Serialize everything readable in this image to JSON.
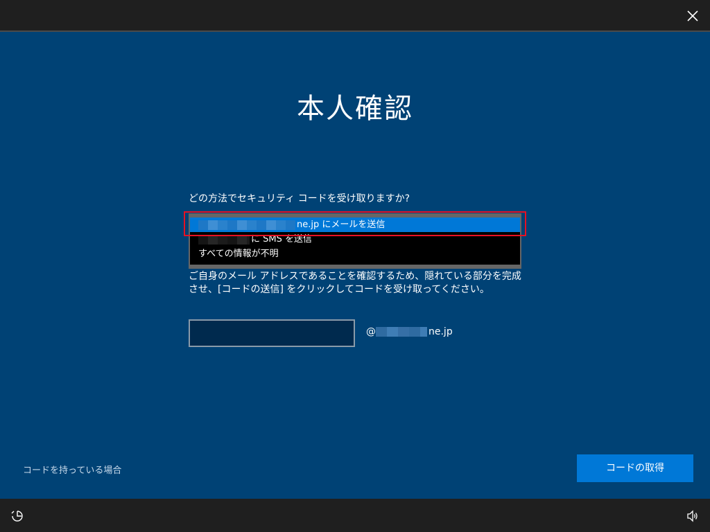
{
  "header": {
    "close_icon": "close-icon"
  },
  "title": "本人確認",
  "question": "どの方法でセキュリティ コードを受け取りますか?",
  "options": [
    {
      "suffix": "ne.jp にメールを送信",
      "selected": true
    },
    {
      "suffix": "に SMS を送信",
      "selected": false
    },
    {
      "suffix": "すべての情報が不明",
      "selected": false
    }
  ],
  "description": "ご自身のメール アドレスであることを確認するため、隠れている部分を完成させ、[コードの送信] をクリックしてコードを受け取ってください。",
  "email_input": {
    "value": "",
    "placeholder": ""
  },
  "email_suffix": {
    "at": "@",
    "domain_end": "ne.jp"
  },
  "links": {
    "have_code": "コードを持っている場合"
  },
  "buttons": {
    "get_code": "コードの取得"
  },
  "footer": {
    "ease_icon": "ease-of-access-icon",
    "volume_icon": "volume-icon"
  },
  "colors": {
    "background": "#004275",
    "accent": "#0078d7",
    "highlight": "#e81123",
    "bar": "#1f1f1f"
  }
}
